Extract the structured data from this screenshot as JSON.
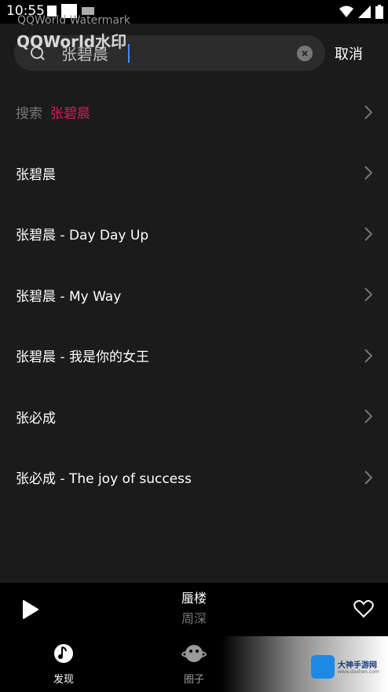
{
  "status_bar": {
    "time": "10:55"
  },
  "watermark": {
    "small": "QQWorld Watermark",
    "big": "QQWorld水印"
  },
  "search": {
    "query": "张碧晨",
    "cancel_label": "取消"
  },
  "suggestions": {
    "search_label": "搜索",
    "search_keyword": "张碧晨",
    "items": [
      "张碧晨",
      "张碧晨 - Day Day Up",
      "张碧晨 - My Way",
      "张碧晨 - 我是你的女王",
      "张必成",
      "张必成 - The  joy of success"
    ]
  },
  "player": {
    "title": "蜃楼",
    "artist": "周深"
  },
  "bottom_nav": {
    "items": [
      {
        "label": "发现",
        "icon": "music-note-icon"
      },
      {
        "label": "圈子",
        "icon": "planet-icon"
      }
    ]
  },
  "logo": {
    "text": "大神手游网",
    "subtext": "www.dashen.com"
  },
  "colors": {
    "accent": "#d81b60",
    "background": "#1b1b1b",
    "bar": "#000000"
  }
}
